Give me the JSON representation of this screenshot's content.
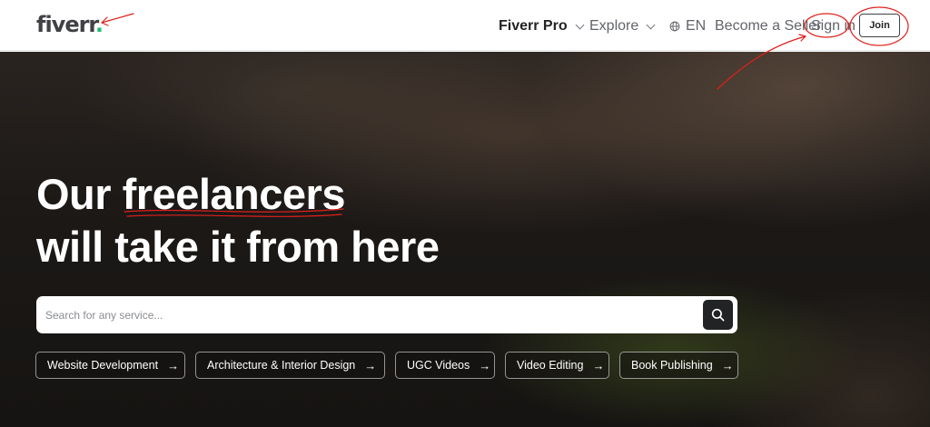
{
  "header": {
    "logo_text": "fiverr",
    "logo_dot": ".",
    "nav": {
      "pro": "Fiverr Pro",
      "explore": "Explore",
      "language": "EN",
      "become_seller": "Become a Seller",
      "sign_in": "Sign in",
      "join": "Join"
    }
  },
  "hero": {
    "headline_line1_a": "Our ",
    "headline_line1_b": "freelancers",
    "headline_line2": "will take it from here",
    "search": {
      "placeholder": "Search for any service...",
      "value": ""
    },
    "chips": [
      "Website Development",
      "Architecture & Interior Design",
      "UGC Videos",
      "Video Editing",
      "Book Publishing"
    ]
  },
  "colors": {
    "brand_green": "#1dbf73",
    "annotation_red": "#e0201c",
    "text_dark": "#404145"
  },
  "icons": [
    "globe-icon",
    "chevron-down-icon",
    "search-icon",
    "arrow-right-icon"
  ]
}
